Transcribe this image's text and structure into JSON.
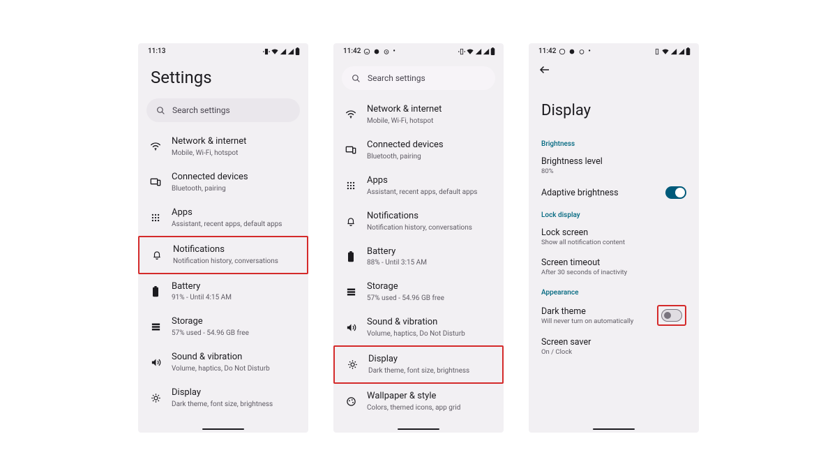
{
  "screen1": {
    "time": "11:13",
    "title": "Settings",
    "search_placeholder": "Search settings",
    "items": [
      {
        "title": "Network & internet",
        "sub": "Mobile, Wi-Fi, hotspot"
      },
      {
        "title": "Connected devices",
        "sub": "Bluetooth, pairing"
      },
      {
        "title": "Apps",
        "sub": "Assistant, recent apps, default apps"
      },
      {
        "title": "Notifications",
        "sub": "Notification history, conversations"
      },
      {
        "title": "Battery",
        "sub": "91% - Until 4:15 AM"
      },
      {
        "title": "Storage",
        "sub": "57% used - 54.96 GB free"
      },
      {
        "title": "Sound & vibration",
        "sub": "Volume, haptics, Do Not Disturb"
      },
      {
        "title": "Display",
        "sub": "Dark theme, font size, brightness"
      }
    ]
  },
  "screen2": {
    "time": "11:42",
    "search_placeholder": "Search settings",
    "items": [
      {
        "title": "Network & internet",
        "sub": "Mobile, Wi-Fi, hotspot"
      },
      {
        "title": "Connected devices",
        "sub": "Bluetooth, pairing"
      },
      {
        "title": "Apps",
        "sub": "Assistant, recent apps, default apps"
      },
      {
        "title": "Notifications",
        "sub": "Notification history, conversations"
      },
      {
        "title": "Battery",
        "sub": "88% - Until 3:15 AM"
      },
      {
        "title": "Storage",
        "sub": "57% used - 54.96 GB free"
      },
      {
        "title": "Sound & vibration",
        "sub": "Volume, haptics, Do Not Disturb"
      },
      {
        "title": "Display",
        "sub": "Dark theme, font size, brightness"
      },
      {
        "title": "Wallpaper & style",
        "sub": "Colors, themed icons, app grid"
      }
    ]
  },
  "screen3": {
    "time": "11:42",
    "title": "Display",
    "sections": {
      "brightness": {
        "header": "Brightness",
        "level_title": "Brightness level",
        "level_sub": "80%",
        "adaptive_title": "Adaptive brightness"
      },
      "lock": {
        "header": "Lock display",
        "lockscreen_title": "Lock screen",
        "lockscreen_sub": "Show all notification content",
        "timeout_title": "Screen timeout",
        "timeout_sub": "After 30 seconds of inactivity"
      },
      "appearance": {
        "header": "Appearance",
        "dark_title": "Dark theme",
        "dark_sub": "Will never turn on automatically",
        "saver_title": "Screen saver",
        "saver_sub": "On / Clock"
      }
    }
  }
}
